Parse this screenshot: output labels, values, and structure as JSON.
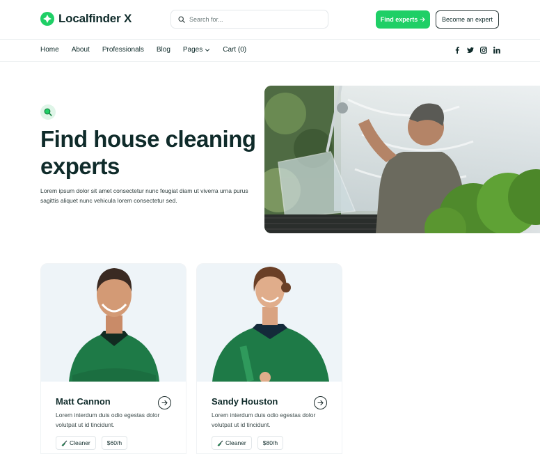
{
  "brand": {
    "name": "Localfinder X",
    "color": "#1fcf66",
    "dark": "#0f2b2a"
  },
  "header": {
    "search_placeholder": "Search for...",
    "find_experts": "Find experts",
    "become_expert": "Become an expert"
  },
  "nav": {
    "items": [
      "Home",
      "About",
      "Professionals",
      "Blog",
      "Pages",
      "Cart (0)"
    ],
    "social_icons": [
      "facebook-icon",
      "twitter-icon",
      "instagram-icon",
      "linkedin-icon"
    ]
  },
  "hero": {
    "title": "Find house cleaning experts",
    "text": "Lorem ipsum dolor sit amet consectetur nunc feugiat diam ut viverra urna purus sagittis aliquet nunc vehicula lorem consectetur sed."
  },
  "cards": [
    {
      "name": "Matt Cannon",
      "desc": "Lorem interdum duis odio egestas dolor volutpat ut id tincidunt.",
      "tag": "Cleaner",
      "price": "$60/h"
    },
    {
      "name": "Sandy Houston",
      "desc": "Lorem interdum duis odio egestas dolor volutpat ut id tincidunt.",
      "tag": "Cleaner",
      "price": "$80/h"
    }
  ]
}
